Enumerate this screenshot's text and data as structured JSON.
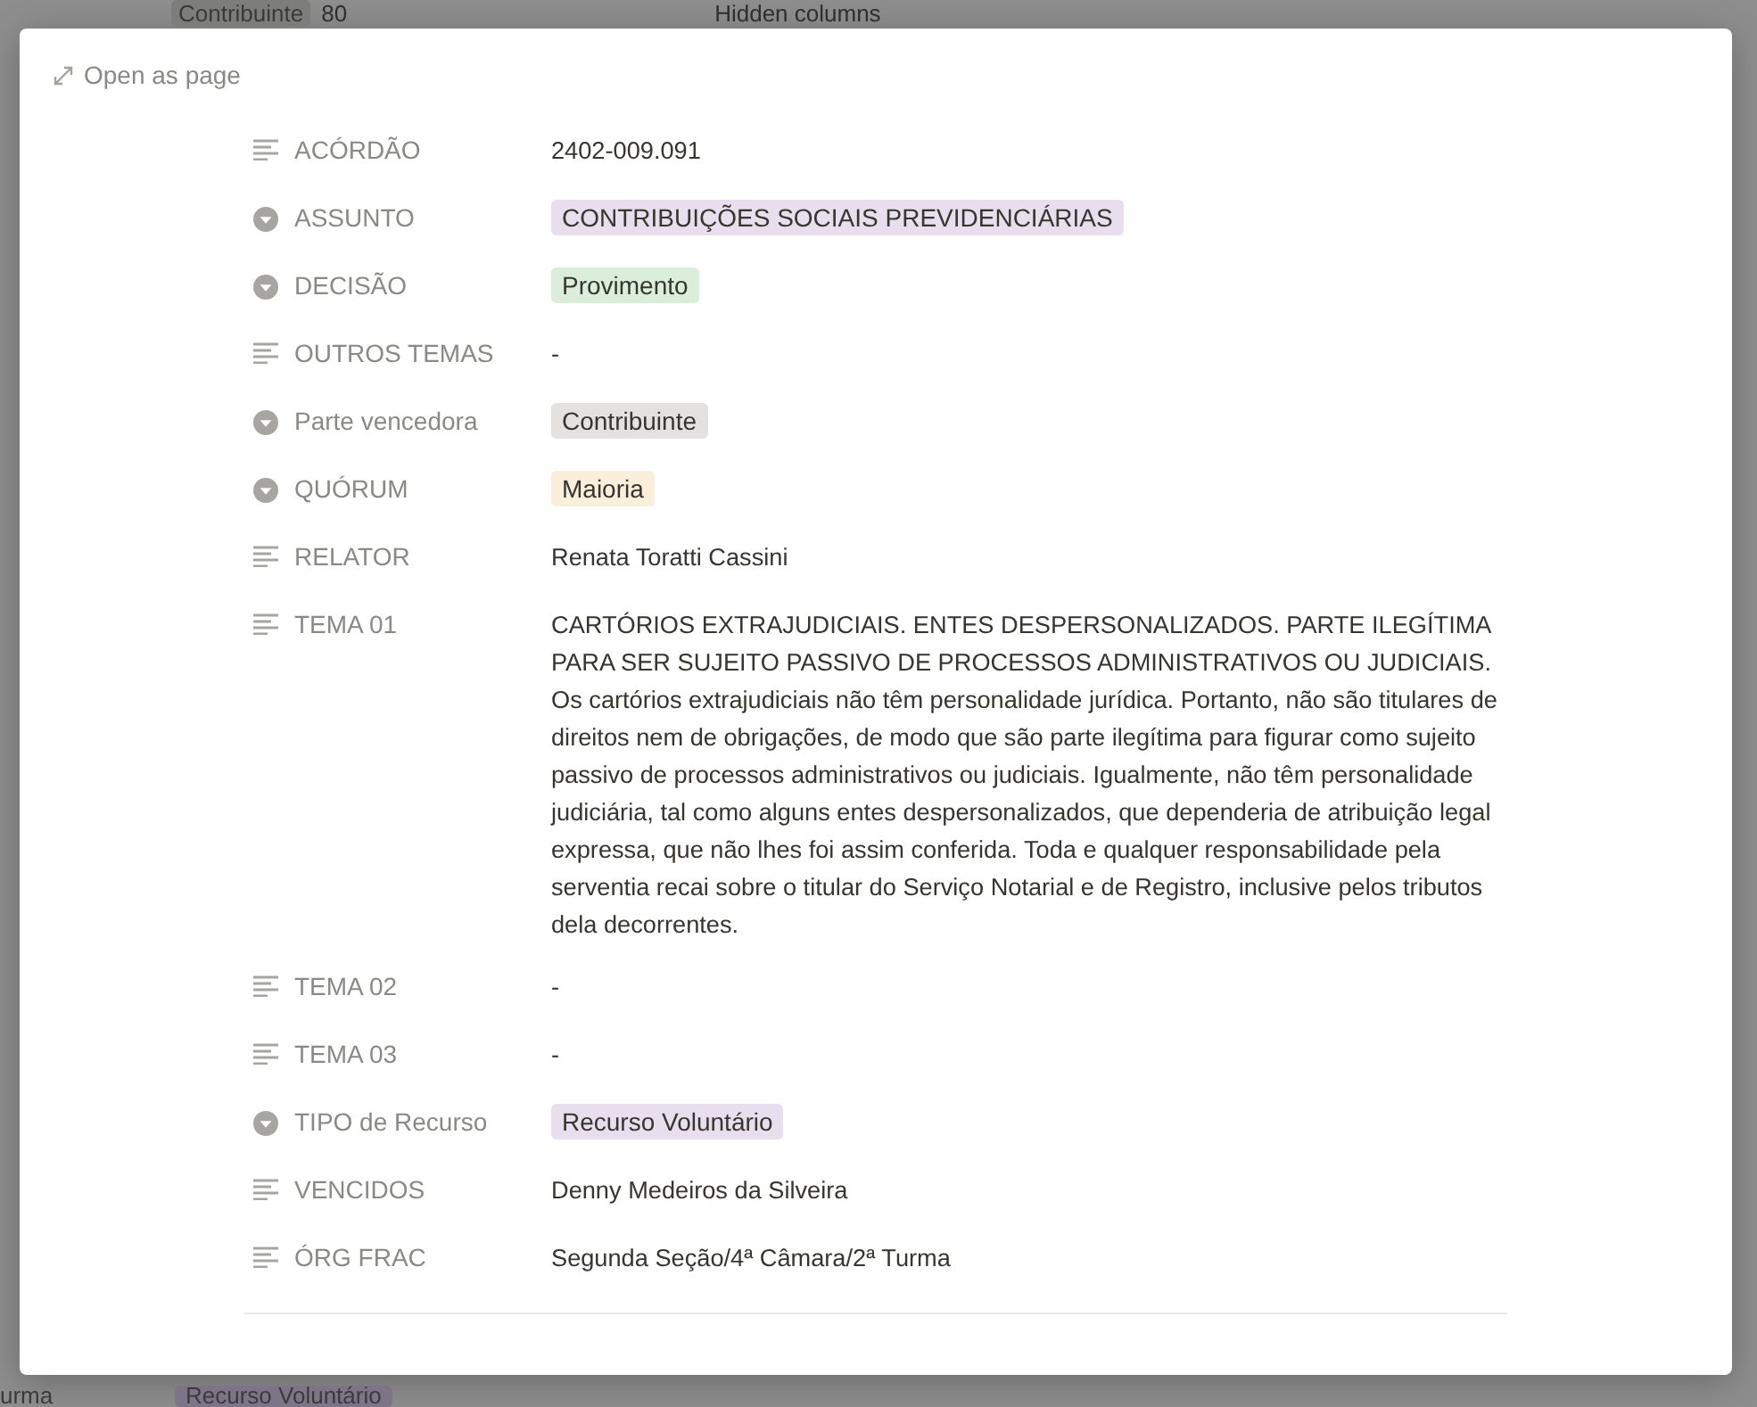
{
  "background": {
    "top": {
      "tag": "Contribuinte",
      "count": "80",
      "hidden_columns": "Hidden columns"
    },
    "bottom": {
      "cell_text": "urma",
      "tag": "Recurso Voluntário"
    }
  },
  "modal": {
    "open_as_page": "Open as page",
    "properties": [
      {
        "kind": "text",
        "label": "ACÓRDÃO",
        "value": "2402-009.091"
      },
      {
        "kind": "select",
        "label": "ASSUNTO",
        "value": "CONTRIBUIÇÕES SOCIAIS PREVIDENCIÁRIAS",
        "color": "#e8deee"
      },
      {
        "kind": "select",
        "label": "DECISÃO",
        "value": "Provimento",
        "color": "#dbeddb"
      },
      {
        "kind": "text",
        "label": "OUTROS TEMAS",
        "value": "-"
      },
      {
        "kind": "select",
        "label": "Parte vencedora",
        "value": "Contribuinte",
        "color": "#e3e2e0"
      },
      {
        "kind": "select",
        "label": "QUÓRUM",
        "value": "Maioria",
        "color": "#fbeedb"
      },
      {
        "kind": "text",
        "label": "RELATOR",
        "value": "Renata Toratti Cassini"
      },
      {
        "kind": "text",
        "label": "TEMA 01",
        "value": "CARTÓRIOS EXTRAJUDICIAIS. ENTES DESPERSONALIZADOS. PARTE ILEGÍTIMA PARA SER SUJEITO PASSIVO DE PROCESSOS ADMINISTRATIVOS OU JUDICIAIS. Os cartórios extrajudiciais não têm personalidade jurídica. Portanto, não são titulares de direitos nem de obrigações, de modo que são parte ilegítima para figurar como sujeito passivo de processos administrativos ou judiciais. Igualmente, não têm personalidade judiciária, tal como alguns entes despersonalizados, que dependeria de atribuição legal expressa, que não lhes foi assim conferida. Toda e qualquer responsabilidade pela serventia recai sobre o titular do Serviço Notarial e de Registro, inclusive pelos tributos dela decorrentes."
      },
      {
        "kind": "text",
        "label": "TEMA 02",
        "value": "-"
      },
      {
        "kind": "text",
        "label": "TEMA 03",
        "value": "-"
      },
      {
        "kind": "select",
        "label": "TIPO de Recurso",
        "value": "Recurso Voluntário",
        "color": "#e8deee"
      },
      {
        "kind": "text",
        "label": "VENCIDOS",
        "value": "Denny Medeiros da Silveira"
      },
      {
        "kind": "text",
        "label": "ÓRG FRAC",
        "value": "Segunda Seção/4ª Câmara/2ª Turma"
      }
    ]
  }
}
